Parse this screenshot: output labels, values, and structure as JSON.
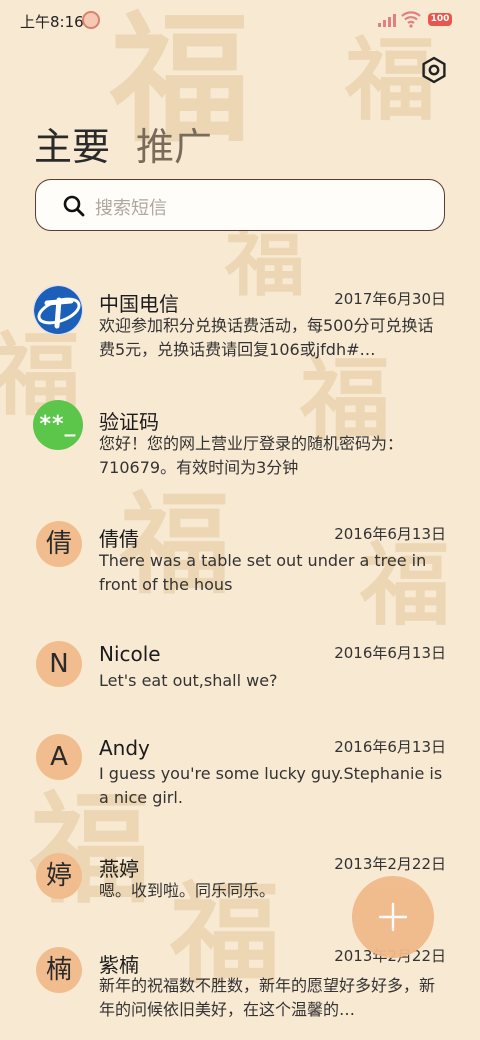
{
  "status_bar": {
    "time": "上午8:16",
    "battery": "100"
  },
  "header": {
    "tabs": [
      {
        "label": "主要"
      },
      {
        "label": "推广"
      }
    ]
  },
  "search": {
    "placeholder": "搜索短信"
  },
  "messages": [
    {
      "sender": "中国电信",
      "date": "2017年6月30日",
      "preview": "欢迎参加积分兑换话费活动，每500分可兑换话费5元，兑换话费请回复106或jfdh#…",
      "avatar_text": "",
      "avatar_type": "telecom"
    },
    {
      "sender": "验证码",
      "date": "",
      "preview": "您好！您的网上营业厅登录的随机密码为：710679。有效时间为3分钟",
      "avatar_text": "**_",
      "avatar_type": "green"
    },
    {
      "sender": "倩倩",
      "date": "2016年6月13日",
      "preview": "There was a table set out under a tree in front of the hous",
      "avatar_text": "倩",
      "avatar_type": "orange"
    },
    {
      "sender": "Nicole",
      "date": "2016年6月13日",
      "preview": "Let's eat out,shall we?",
      "avatar_text": "N",
      "avatar_type": "orange"
    },
    {
      "sender": "Andy",
      "date": "2016年6月13日",
      "preview": "I guess you're some lucky guy.Stephanie is a nice girl.",
      "avatar_text": "A",
      "avatar_type": "orange"
    },
    {
      "sender": "燕婷",
      "date": "2013年2月22日",
      "preview": "嗯。收到啦。同乐同乐。",
      "avatar_text": "婷",
      "avatar_type": "orange"
    },
    {
      "sender": "紫楠",
      "date": "2013年2月22日",
      "preview": "新年的祝福数不胜数，新年的愿望好多好多，新年的问候依旧美好，在这个温馨的…",
      "avatar_text": "楠",
      "avatar_type": "orange"
    }
  ],
  "colors": {
    "background": "#f8e9d3",
    "avatar": "#f2bd8e",
    "fab": "#f0b98a",
    "verify_avatar": "#5cc64a"
  },
  "icons": [
    "settings-icon",
    "search-icon",
    "add-icon",
    "china-telecom-logo"
  ]
}
